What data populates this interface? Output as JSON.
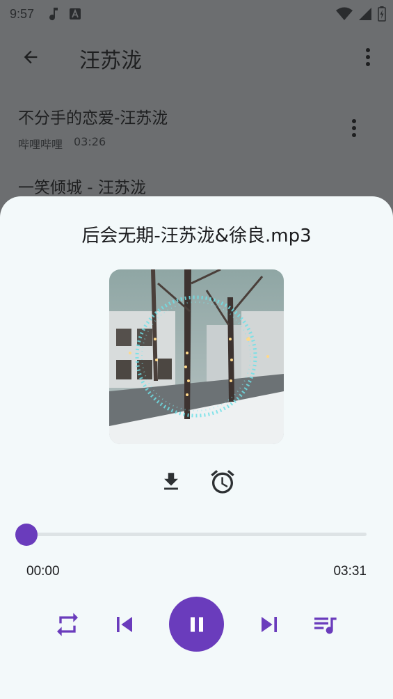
{
  "status_bar": {
    "time": "9:57",
    "icons_left": [
      "music-note-icon",
      "text-a-icon"
    ],
    "icons_right": [
      "wifi-icon",
      "signal-icon",
      "battery-icon"
    ]
  },
  "app_bar": {
    "title": "汪苏泷",
    "back_icon": "arrow-back-icon",
    "more_icon": "more-vert-icon"
  },
  "song_list": {
    "items": [
      {
        "title": "不分手的恋爱-汪苏泷",
        "source": "哔哩哔哩",
        "duration": "03:26"
      },
      {
        "title": "一笑倾城 - 汪苏泷",
        "source": "",
        "duration": ""
      }
    ]
  },
  "player": {
    "track_title": "后会无期-汪苏泷&徐良.mp3",
    "current_time": "00:00",
    "total_time": "03:31",
    "progress_fraction": 0.0,
    "accent_color": "#6a3cbc",
    "controls": {
      "repeat_icon": "repeat-icon",
      "prev_icon": "skip-previous-icon",
      "play_pause_icon": "pause-icon",
      "next_icon": "skip-next-icon",
      "queue_icon": "queue-music-icon"
    },
    "actions": {
      "download_icon": "download-icon",
      "alarm_icon": "alarm-icon"
    }
  }
}
